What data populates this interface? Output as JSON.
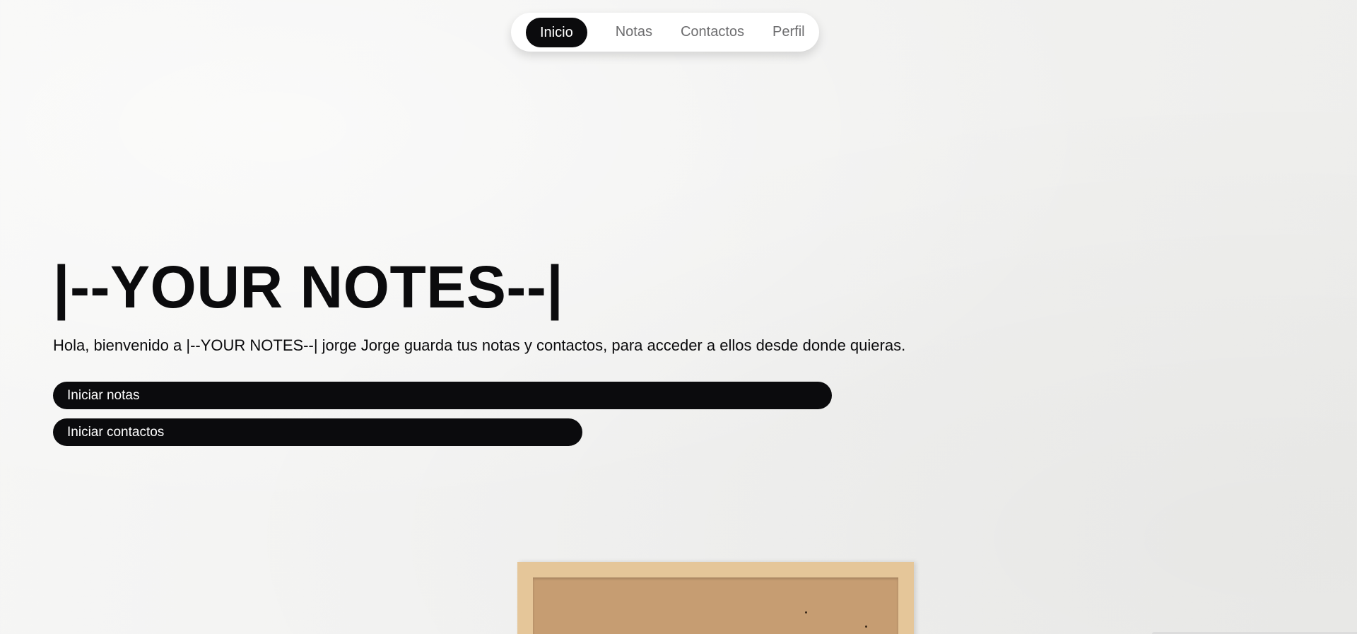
{
  "nav": {
    "items": [
      {
        "label": "Inicio",
        "active": true
      },
      {
        "label": "Notas",
        "active": false
      },
      {
        "label": "Contactos",
        "active": false
      },
      {
        "label": "Perfil",
        "active": false
      }
    ]
  },
  "hero": {
    "title": "|--YOUR NOTES--|",
    "description": "Hola, bienvenido a |--YOUR NOTES--| jorge Jorge guarda tus notas y contactos, para acceder a ellos desde donde quieras.",
    "buttons": {
      "notes_label": "Iniciar notas",
      "contacts_label": "Iniciar contactos"
    }
  },
  "colors": {
    "accent": "#0b0b0d",
    "nav_background": "#ffffff",
    "page_background": "#f3f3f2",
    "board_frame": "#e5c699",
    "board_cork": "#c69d72"
  }
}
